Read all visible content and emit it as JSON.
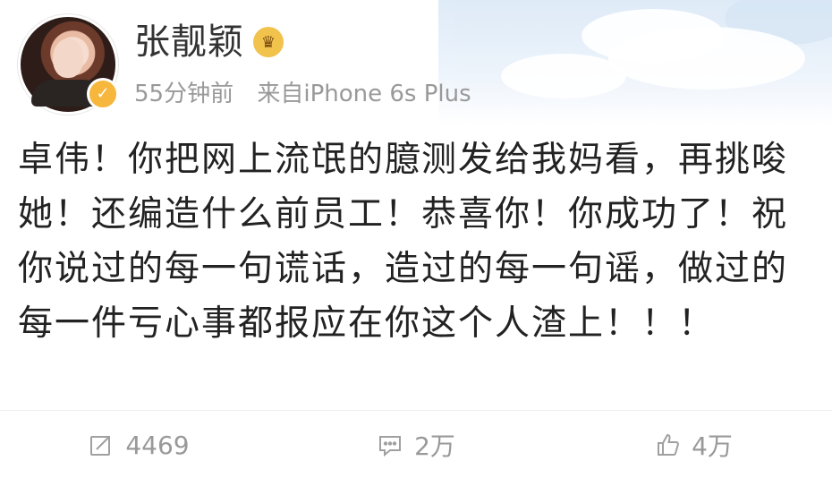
{
  "post": {
    "author": {
      "name": "张靓颖",
      "time": "55分钟前",
      "source": "来自iPhone 6s Plus"
    },
    "body": "卓伟！你把网上流氓的臆测发给我妈看，再挑唆她！还编造什么前员工！恭喜你！你成功了！祝你说过的每一句谎话，造过的每一句谣，做过的每一件亏心事都报应在你这个人渣上！！！",
    "actions": {
      "repost": "4469",
      "comment": "2万",
      "like": "4万"
    }
  },
  "icons": {
    "verified": "verified-badge-icon",
    "level": "member-level-icon",
    "repost": "repost-icon",
    "comment": "comment-icon",
    "like": "thumbs-up-icon"
  },
  "colors": {
    "text": "#222222",
    "secondary": "#999999",
    "verified": "#f6b73c",
    "divider": "#eeeeee"
  }
}
